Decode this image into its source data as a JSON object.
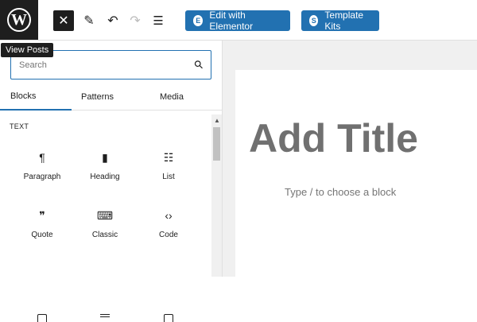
{
  "toolbar": {
    "close_glyph": "✕",
    "pen_glyph": "✎",
    "undo_glyph": "↶",
    "redo_glyph": "↷",
    "list_glyph": "☰",
    "elementor_icon": "E",
    "elementor_label": "Edit with Elementor",
    "template_icon": "S",
    "template_label": "Template Kits",
    "accent": "#2271b1"
  },
  "logo": {
    "glyph": "W",
    "tooltip": "View Posts"
  },
  "sidebar": {
    "search_placeholder": "Search",
    "search_glyph": "⚲",
    "tabs": [
      "Blocks",
      "Patterns",
      "Media"
    ],
    "section_title": "TEXT",
    "blocks": [
      {
        "label": "Paragraph",
        "glyph": "¶",
        "icon": "paragraph-icon"
      },
      {
        "label": "Heading",
        "glyph": "▮",
        "icon": "bookmark-icon"
      },
      {
        "label": "List",
        "glyph": "☷",
        "icon": "list-icon"
      },
      {
        "label": "Quote",
        "glyph": "❞",
        "icon": "quote-icon"
      },
      {
        "label": "Classic",
        "glyph": "⌨",
        "icon": "keyboard-icon"
      },
      {
        "label": "Code",
        "glyph": "‹›",
        "icon": "code-icon"
      }
    ]
  },
  "canvas": {
    "title_placeholder": "Add Title",
    "block_placeholder": "Type / to choose a block"
  }
}
